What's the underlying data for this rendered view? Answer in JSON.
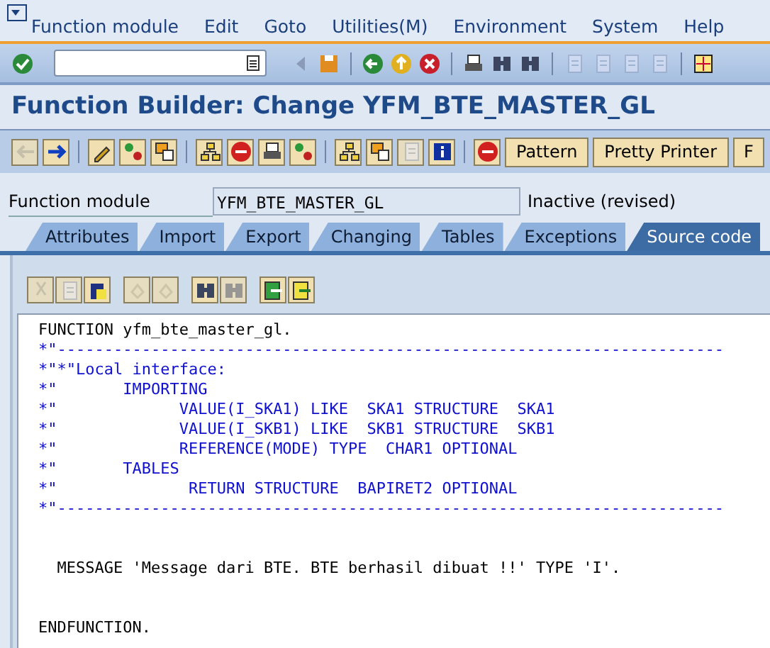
{
  "menu_bar": {
    "items": [
      "Function module",
      "Edit",
      "Goto",
      "Utilities(M)",
      "Environment",
      "System",
      "Help"
    ]
  },
  "title": "Function Builder: Change YFM_BTE_MASTER_GL",
  "app_toolbar": {
    "buttons": [
      "Pattern",
      "Pretty Printer",
      "F"
    ]
  },
  "header": {
    "label": "Function module",
    "value": "YFM_BTE_MASTER_GL",
    "status": "Inactive (revised)"
  },
  "tabs": [
    {
      "label": "Attributes",
      "selected": false
    },
    {
      "label": "Import",
      "selected": false
    },
    {
      "label": "Export",
      "selected": false
    },
    {
      "label": "Changing",
      "selected": false
    },
    {
      "label": "Tables",
      "selected": false
    },
    {
      "label": "Exceptions",
      "selected": false
    },
    {
      "label": "Source code",
      "selected": true
    }
  ],
  "editor": {
    "lines": [
      {
        "kind": "code",
        "text": "FUNCTION yfm_bte_master_gl."
      },
      {
        "kind": "comment",
        "text": "*\"-----------------------------------------------------------------------"
      },
      {
        "kind": "comment",
        "text": "*\"*\"Local interface:"
      },
      {
        "kind": "comment",
        "text": "*\"       IMPORTING"
      },
      {
        "kind": "comment",
        "text": "*\"             VALUE(I_SKA1) LIKE  SKA1 STRUCTURE  SKA1"
      },
      {
        "kind": "comment",
        "text": "*\"             VALUE(I_SKB1) LIKE  SKB1 STRUCTURE  SKB1"
      },
      {
        "kind": "comment",
        "text": "*\"             REFERENCE(MODE) TYPE  CHAR1 OPTIONAL"
      },
      {
        "kind": "comment",
        "text": "*\"       TABLES"
      },
      {
        "kind": "comment",
        "text": "*\"              RETURN STRUCTURE  BAPIRET2 OPTIONAL"
      },
      {
        "kind": "comment",
        "text": "*\"-----------------------------------------------------------------------"
      },
      {
        "kind": "blank"
      },
      {
        "kind": "blank"
      },
      {
        "kind": "code",
        "text": "  MESSAGE 'Message dari BTE. BTE berhasil dibuat !!' TYPE 'I'."
      },
      {
        "kind": "blank"
      },
      {
        "kind": "blank"
      },
      {
        "kind": "code",
        "text": "ENDFUNCTION."
      }
    ]
  }
}
